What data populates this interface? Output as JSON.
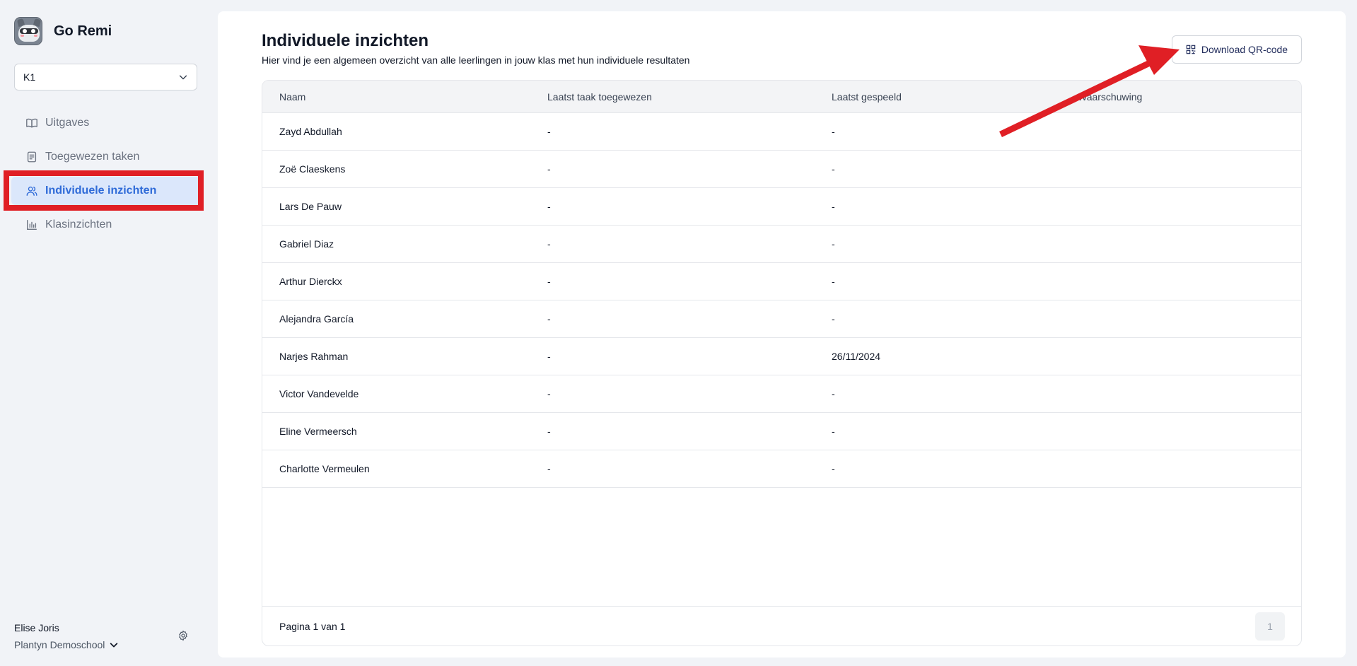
{
  "app": {
    "name": "Go Remi"
  },
  "class_select": {
    "value": "K1"
  },
  "sidebar": {
    "items": [
      {
        "label": "Uitgaves"
      },
      {
        "label": "Toegewezen taken"
      },
      {
        "label": "Individuele inzichten"
      },
      {
        "label": "Klasinzichten"
      }
    ]
  },
  "user": {
    "name": "Elise Joris",
    "school": "Plantyn Demoschool"
  },
  "page": {
    "title": "Individuele inzichten",
    "subtitle": "Hier vind je een algemeen overzicht van alle leerlingen in jouw klas met hun individuele resultaten",
    "qr_button": "Download QR-code"
  },
  "table": {
    "headers": [
      "Naam",
      "Laatst taak toegewezen",
      "Laatst gespeeld",
      "Waarschuwing"
    ],
    "rows": [
      [
        "Zayd Abdullah",
        "-",
        "-",
        ""
      ],
      [
        "Zoë Claeskens",
        "-",
        "-",
        ""
      ],
      [
        "Lars De Pauw",
        "-",
        "-",
        ""
      ],
      [
        "Gabriel Diaz",
        "-",
        "-",
        ""
      ],
      [
        "Arthur Dierckx",
        "-",
        "-",
        ""
      ],
      [
        "Alejandra García",
        "-",
        "-",
        ""
      ],
      [
        "Narjes Rahman",
        "-",
        "26/11/2024",
        ""
      ],
      [
        "Victor Vandevelde",
        "-",
        "-",
        ""
      ],
      [
        "Eline Vermeersch",
        "-",
        "-",
        ""
      ],
      [
        "Charlotte Vermeulen",
        "-",
        "-",
        ""
      ]
    ]
  },
  "pagination": {
    "text": "Pagina 1 van 1",
    "current": "1"
  },
  "colors": {
    "accent": "#2f6bd8",
    "highlight": "#e01f25",
    "active_bg": "#dbe7fb"
  }
}
